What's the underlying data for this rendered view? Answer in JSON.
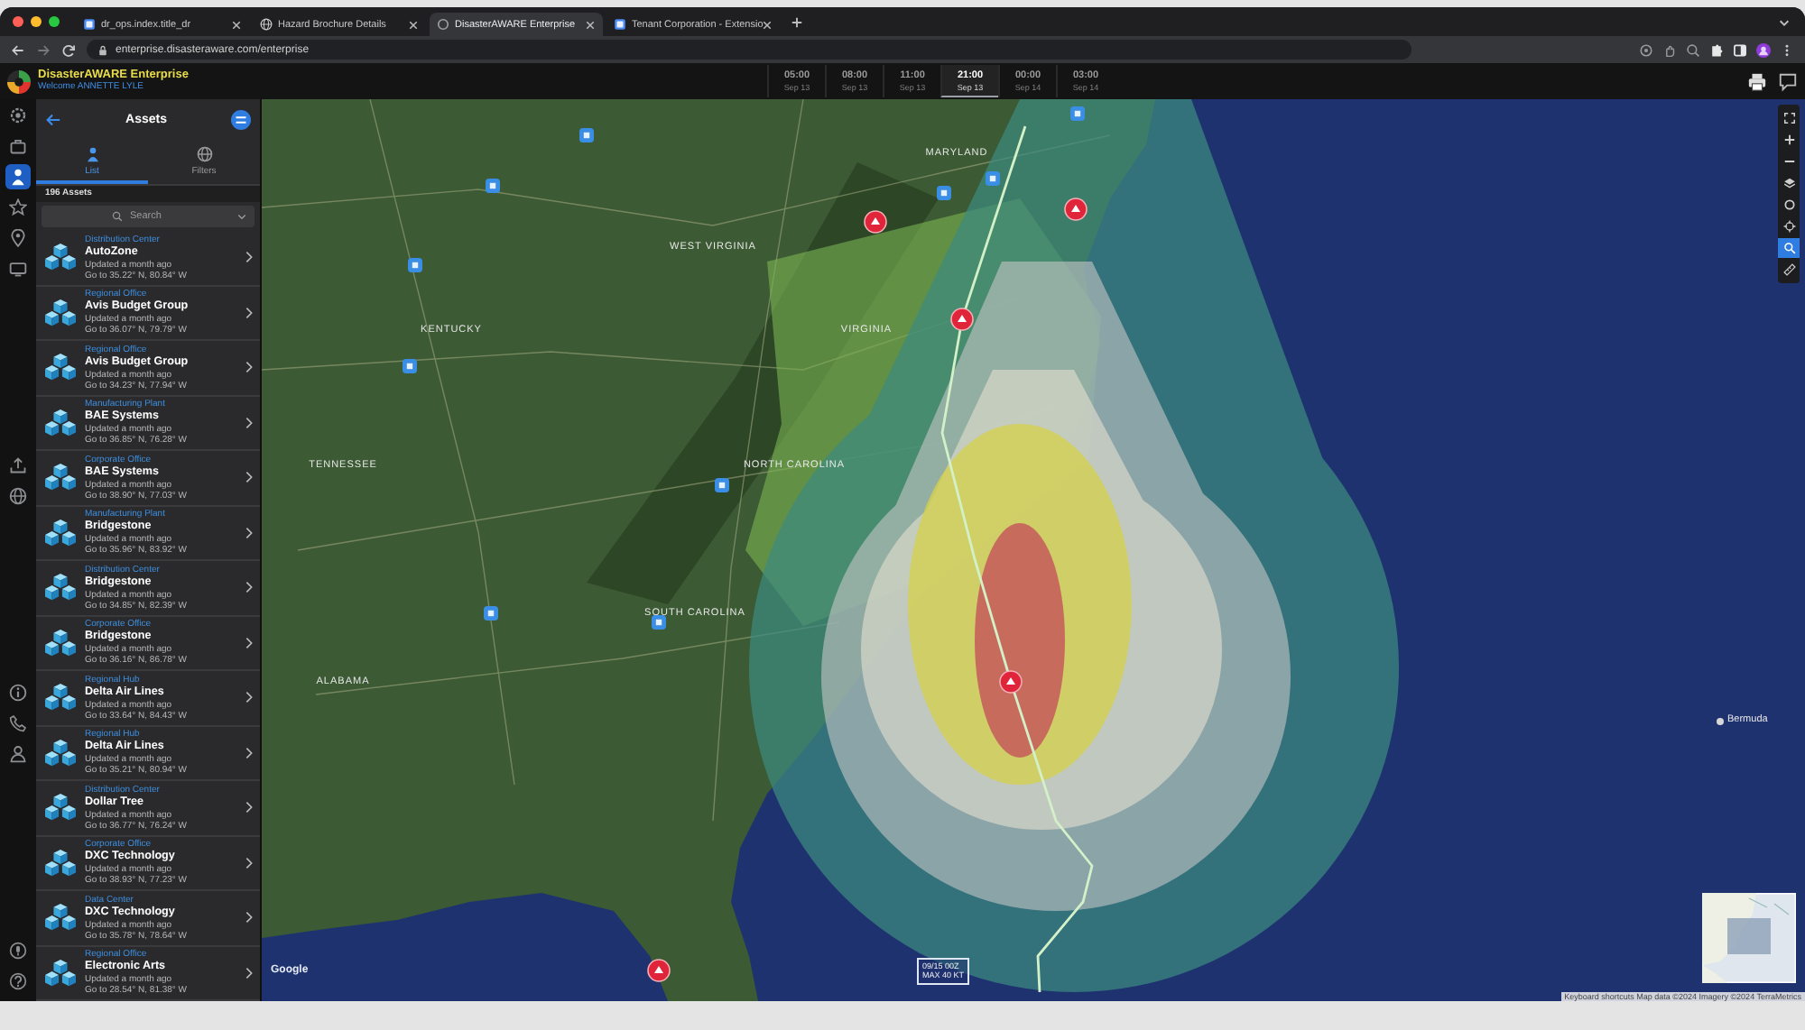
{
  "browser": {
    "tabs": [
      {
        "title": "dr_ops.index.title_dr",
        "selected": false
      },
      {
        "title": "Hazard Brochure Details",
        "selected": false
      },
      {
        "title": "DisasterAWARE Enterprise",
        "selected": true
      },
      {
        "title": "Tenant Corporation - Extensio",
        "selected": false
      }
    ],
    "address": "enterprise.disasteraware.com/enterprise"
  },
  "app_header": {
    "title": "DisasterAWARE Enterprise",
    "subtitle": "Welcome ANNETTE LYLE",
    "timeline": [
      {
        "date": "Sep 13",
        "time": "05:00",
        "selected": false
      },
      {
        "date": "Sep 13",
        "time": "08:00",
        "selected": false
      },
      {
        "date": "Sep 13",
        "time": "11:00",
        "selected": false
      },
      {
        "date": "Sep 13",
        "time": "21:00",
        "selected": true
      },
      {
        "date": "Sep 14",
        "time": "00:00",
        "selected": false
      },
      {
        "date": "Sep 14",
        "time": "03:00",
        "selected": false
      }
    ]
  },
  "rail": {
    "groups": [
      {
        "items": [
          {
            "selected": false
          },
          {
            "selected": false
          },
          {
            "selected": true
          },
          {
            "selected": false
          },
          {
            "selected": false
          },
          {
            "selected": false
          }
        ]
      },
      {
        "items": [
          {
            "selected": false
          },
          {
            "selected": false
          }
        ]
      },
      {
        "items": [
          {
            "selected": false
          },
          {
            "selected": false
          },
          {
            "selected": false
          }
        ]
      },
      {
        "items": [
          {
            "selected": false
          },
          {
            "selected": false
          }
        ]
      }
    ]
  },
  "sidebar": {
    "title": "Assets",
    "tabs": [
      {
        "label": "List",
        "selected": true
      },
      {
        "label": "Filters",
        "selected": false
      }
    ],
    "count": "196 Assets",
    "search": {
      "placeholder": "Search"
    },
    "assets": [
      {
        "category": "Distribution Center",
        "name": "AutoZone",
        "updated": "Updated a month ago",
        "location": "Go to 35.22° N, 80.84° W"
      },
      {
        "category": "Regional Office",
        "name": "Avis Budget Group",
        "updated": "Updated a month ago",
        "location": "Go to 36.07° N, 79.79° W"
      },
      {
        "category": "Regional Office",
        "name": "Avis Budget Group",
        "updated": "Updated a month ago",
        "location": "Go to 34.23° N, 77.94° W"
      },
      {
        "category": "Manufacturing Plant",
        "name": "BAE Systems",
        "updated": "Updated a month ago",
        "location": "Go to 36.85° N, 76.28° W"
      },
      {
        "category": "Corporate Office",
        "name": "BAE Systems",
        "updated": "Updated a month ago",
        "location": "Go to 38.90° N, 77.03° W"
      },
      {
        "category": "Manufacturing Plant",
        "name": "Bridgestone",
        "updated": "Updated a month ago",
        "location": "Go to 35.96° N, 83.92° W"
      },
      {
        "category": "Distribution Center",
        "name": "Bridgestone",
        "updated": "Updated a month ago",
        "location": "Go to 34.85° N, 82.39° W"
      },
      {
        "category": "Corporate Office",
        "name": "Bridgestone",
        "updated": "Updated a month ago",
        "location": "Go to 36.16° N, 86.78° W"
      },
      {
        "category": "Regional Hub",
        "name": "Delta Air Lines",
        "updated": "Updated a month ago",
        "location": "Go to 33.64° N, 84.43° W"
      },
      {
        "category": "Regional Hub",
        "name": "Delta Air Lines",
        "updated": "Updated a month ago",
        "location": "Go to 35.21° N, 80.94° W"
      },
      {
        "category": "Distribution Center",
        "name": "Dollar Tree",
        "updated": "Updated a month ago",
        "location": "Go to 36.77° N, 76.24° W"
      },
      {
        "category": "Corporate Office",
        "name": "DXC Technology",
        "updated": "Updated a month ago",
        "location": "Go to 38.93° N, 77.23° W"
      },
      {
        "category": "Data Center",
        "name": "DXC Technology",
        "updated": "Updated a month ago",
        "location": "Go to 35.78° N, 78.64° W"
      },
      {
        "category": "Regional Office",
        "name": "Electronic Arts",
        "updated": "Updated a month ago",
        "location": "Go to 28.54° N, 81.38° W"
      }
    ]
  },
  "map": {
    "state_labels": [
      "MARYLAND",
      "WEST VIRGINIA",
      "KENTUCKY",
      "VIRGINIA",
      "TENNESSEE",
      "NORTH CAROLINA",
      "SOUTH CAROLINA",
      "ALABAMA"
    ],
    "place_label": "Bermuda",
    "storm_info": [
      "09/15 00Z",
      "MAX 40 KT"
    ],
    "tools": [
      {
        "selected": false
      },
      {
        "selected": false
      },
      {
        "selected": false
      },
      {
        "selected": false
      },
      {
        "selected": false
      },
      {
        "selected": false
      },
      {
        "selected": true
      },
      {
        "selected": false
      }
    ],
    "logo": "Google",
    "attribution": "Keyboard shortcuts  Map data ©2024 Imagery ©2024 TerraMetrics"
  }
}
